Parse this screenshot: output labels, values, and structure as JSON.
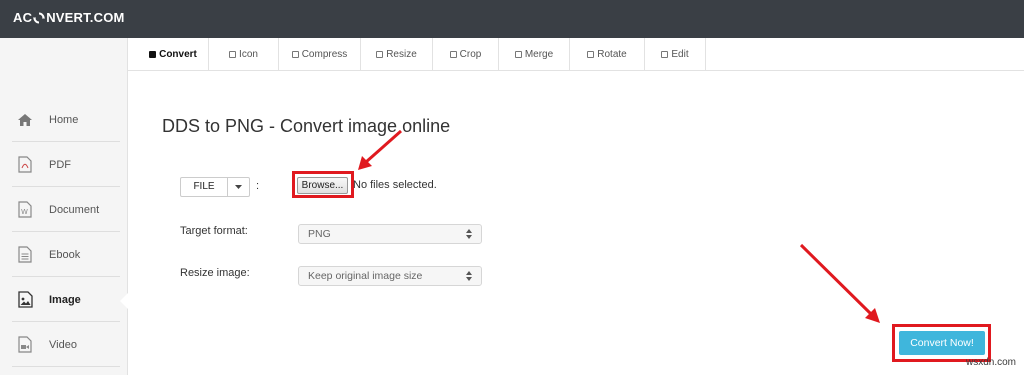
{
  "app": {
    "logo_prefix": "AC",
    "logo_suffix": "NVERT.COM"
  },
  "sidebar": {
    "items": [
      {
        "label": "Home",
        "icon": "home-icon"
      },
      {
        "label": "PDF",
        "icon": "pdf-icon"
      },
      {
        "label": "Document",
        "icon": "document-icon"
      },
      {
        "label": "Ebook",
        "icon": "ebook-icon"
      },
      {
        "label": "Image",
        "icon": "image-icon",
        "active": true
      },
      {
        "label": "Video",
        "icon": "video-icon"
      }
    ]
  },
  "tabs": [
    {
      "label": "Convert",
      "active": true
    },
    {
      "label": "Icon"
    },
    {
      "label": "Compress"
    },
    {
      "label": "Resize"
    },
    {
      "label": "Crop"
    },
    {
      "label": "Merge"
    },
    {
      "label": "Rotate"
    },
    {
      "label": "Edit"
    }
  ],
  "main": {
    "title": "DDS to PNG - Convert image online",
    "file_button_label": "FILE",
    "colon": ":",
    "browse_label": "Browse...",
    "no_file_text": "No files selected.",
    "target_format_label": "Target format:",
    "target_format_value": "PNG",
    "resize_label": "Resize image:",
    "resize_value": "Keep original image size",
    "convert_button_label": "Convert Now!"
  },
  "watermark": "wsxdn.com",
  "colors": {
    "topbar": "#3a3f45",
    "accent": "#3fb6dc",
    "highlight": "#e0191f"
  }
}
